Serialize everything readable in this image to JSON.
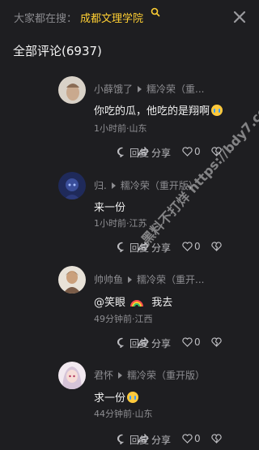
{
  "search": {
    "prefix": "大家都在搜：",
    "term": "成都文理学院"
  },
  "header": {
    "title": "全部评论(6937)"
  },
  "comments": [
    {
      "author": "小薛饿了",
      "reply_to": "糯冷荣（重...",
      "text": "你吃的瓜，他吃的是翔啊",
      "time": "1小时前·山东",
      "reply_label": "回复",
      "share_label": "分享",
      "likes": "0"
    },
    {
      "author": "归.",
      "reply_to": "糯冷荣（重开版）",
      "text": "来一份",
      "time": "1小时前·江苏",
      "reply_label": "回复",
      "share_label": "分享",
      "likes": "0"
    },
    {
      "author": "帅帅鱼",
      "reply_to": "糯冷荣（重开...",
      "text_prefix": "@笑眼",
      "text_suffix": "我去",
      "time": "49分钟前·江西",
      "reply_label": "回复",
      "share_label": "分享",
      "likes": "0"
    },
    {
      "author": "君怀",
      "reply_to": "糯冷荣（重开版）",
      "text": "求一份",
      "time": "44分钟前·山东",
      "reply_label": "回复",
      "share_label": "分享",
      "likes": "0"
    }
  ],
  "watermark": "黑料不打烊 https://bdy7.co",
  "colors": {
    "background": "#1e1e21",
    "accent": "#ffcf33",
    "muted": "#8e8e92"
  }
}
